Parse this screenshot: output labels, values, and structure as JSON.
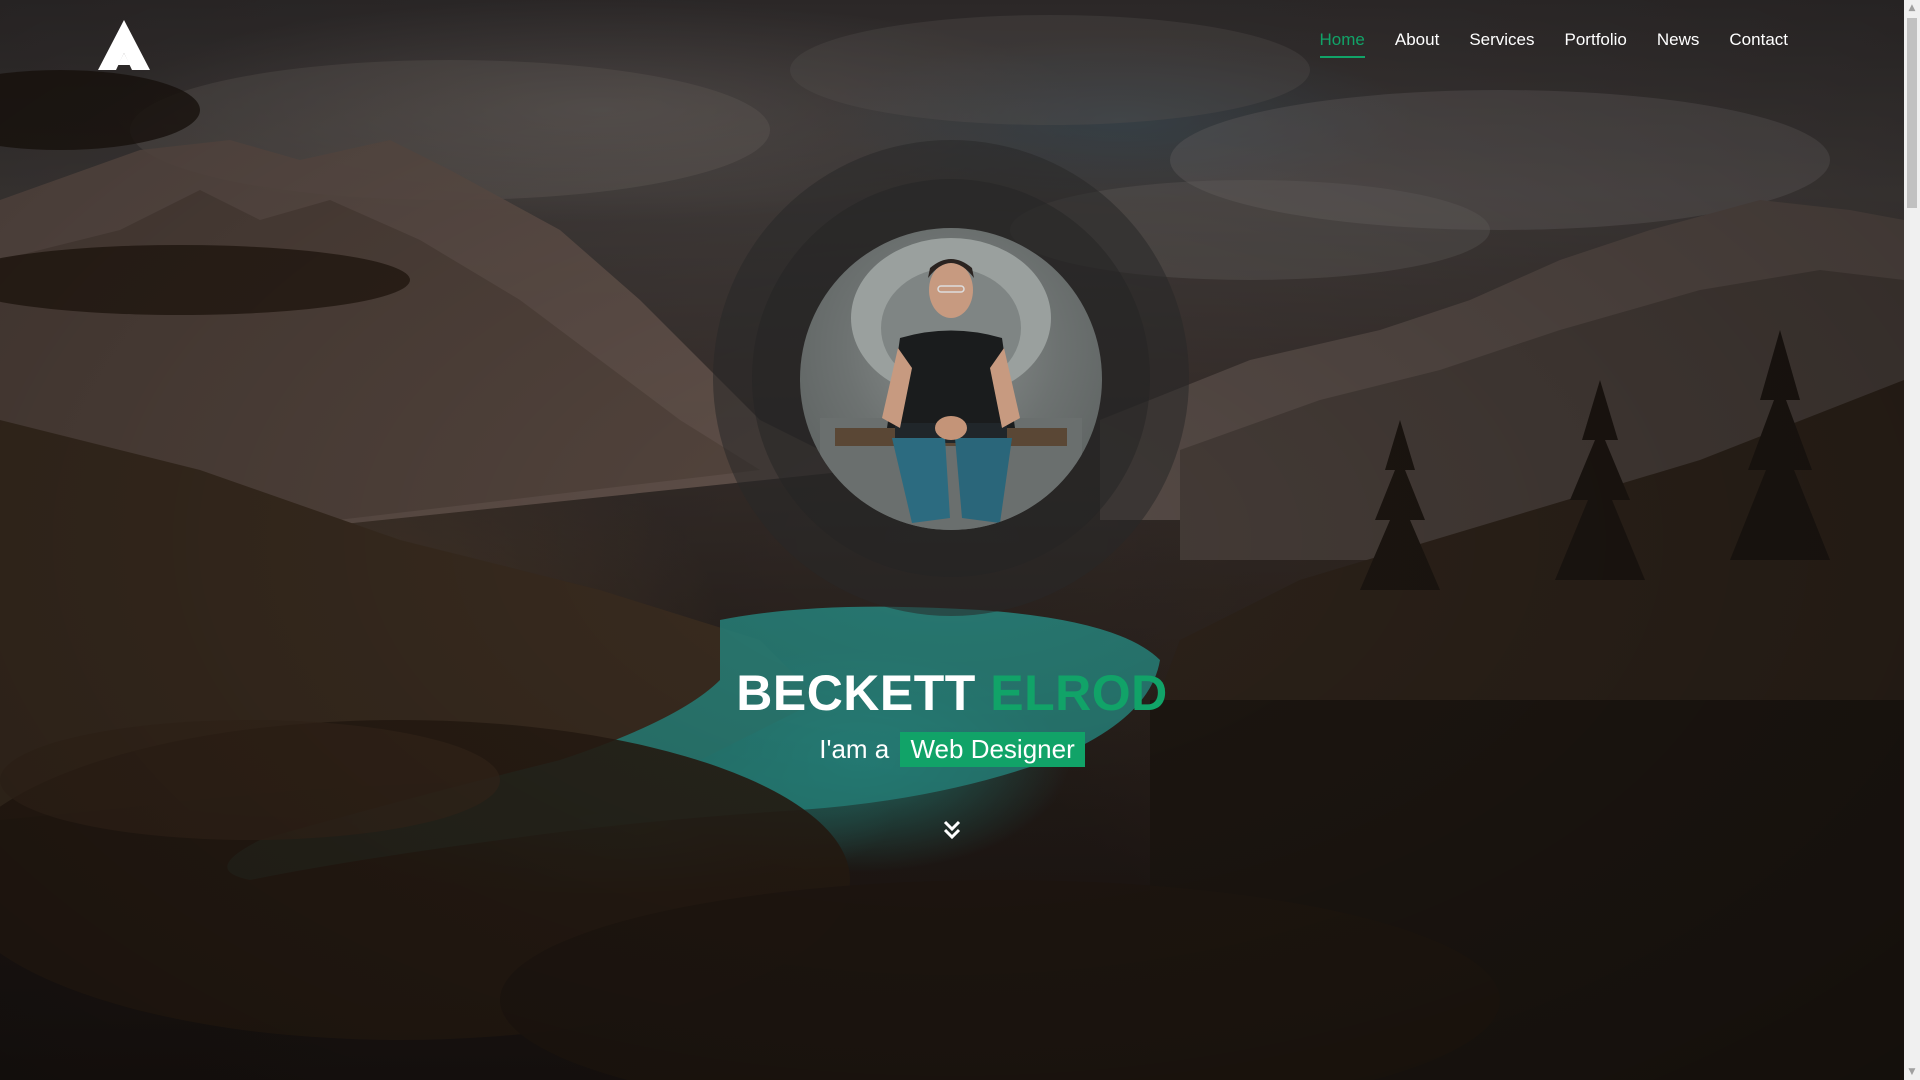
{
  "brand": {
    "logo_icon": "mountain-peak-logo-icon"
  },
  "nav": {
    "items": [
      {
        "label": "Home",
        "active": true
      },
      {
        "label": "About",
        "active": false
      },
      {
        "label": "Services",
        "active": false
      },
      {
        "label": "Portfolio",
        "active": false
      },
      {
        "label": "News",
        "active": false
      },
      {
        "label": "Contact",
        "active": false
      }
    ]
  },
  "hero": {
    "first_name": "BECKETT",
    "last_name": "ELROD",
    "role_prefix": "I'am a",
    "role_highlight": "Web Designer",
    "avatar_icon": "profile-photo",
    "scroll_icon": "double-chevron-down-icon"
  },
  "colors": {
    "accent": "#11a368",
    "text": "#ffffff"
  }
}
